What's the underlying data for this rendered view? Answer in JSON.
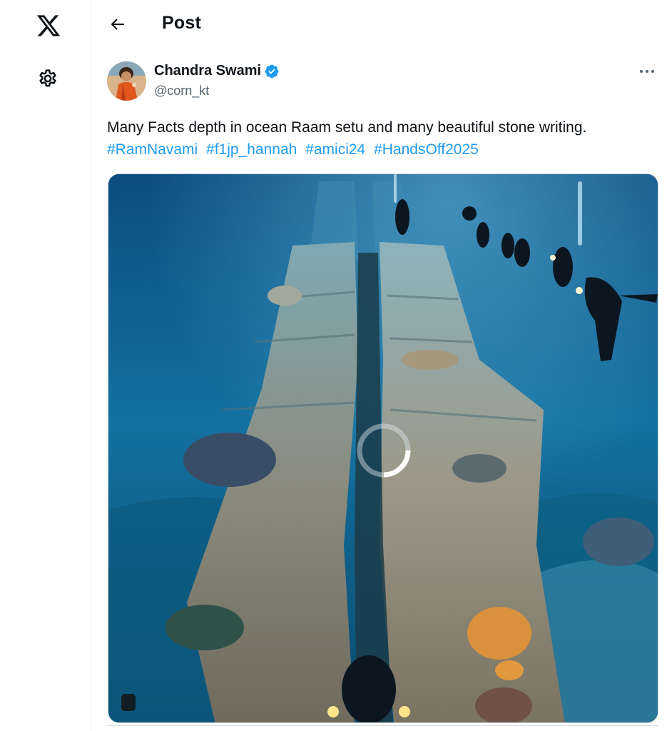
{
  "header": {
    "title": "Post",
    "back_icon": "arrow-left-icon"
  },
  "nav": {
    "logo_icon": "x-logo-icon",
    "settings_icon": "gear-icon"
  },
  "post": {
    "author": {
      "name": "Chandra Swami",
      "handle": "@corn_kt",
      "verified": true,
      "verified_color": "#1d9bf0"
    },
    "text": "Many Facts depth in ocean Raam setu and many beautiful stone writing.",
    "hashtags": [
      "#RamNavami",
      "#f1jp_hannah",
      "#amici24",
      "#HandsOff2025"
    ],
    "more_icon": "more-horizontal-icon",
    "media": {
      "type": "video",
      "state": "loading",
      "loading_icon": "loading-spinner-icon"
    }
  },
  "colors": {
    "accent": "#1d9bf0",
    "text_primary": "#0f1419",
    "text_secondary": "#536471"
  }
}
